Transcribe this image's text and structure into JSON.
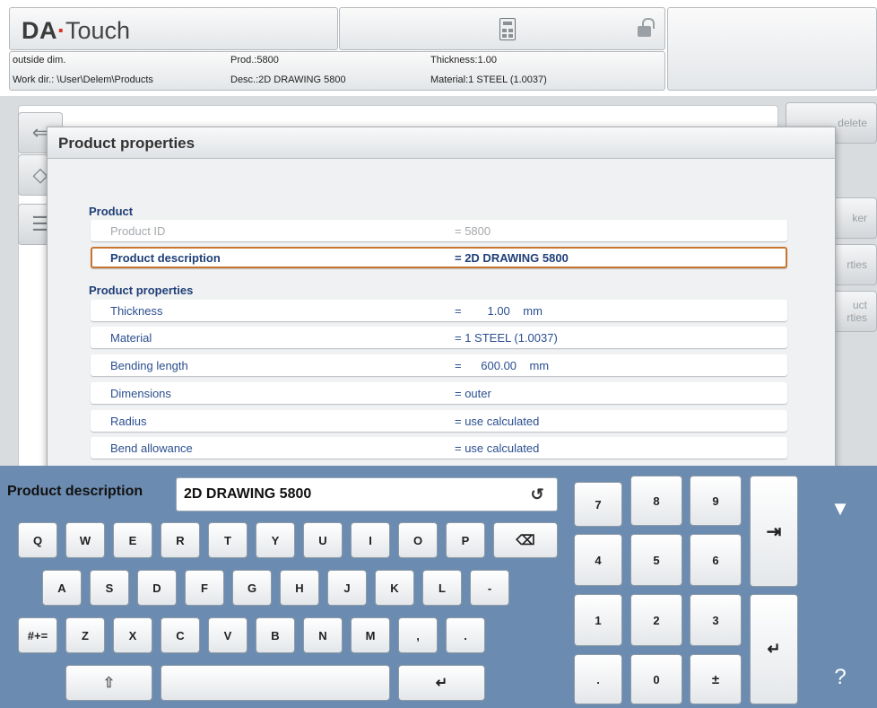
{
  "header": {
    "logo_brand": "DA",
    "logo_dot": "·",
    "logo_product": "Touch",
    "info": {
      "mode": "outside dim.",
      "workdir": "Work dir.: \\User\\Delem\\Products",
      "prod": "Prod.:5800",
      "desc": "Desc.:2D DRAWING 5800",
      "thickness": "Thickness:1.00",
      "material": "Material:1 STEEL (1.0037)"
    }
  },
  "background": {
    "side_buttons": [
      "delete",
      "ker",
      "rties",
      "uct\nrties"
    ]
  },
  "dialog": {
    "title": "Product properties",
    "sections": {
      "product": "Product",
      "properties": "Product properties"
    },
    "rows": [
      {
        "label": "Product ID",
        "value": "= 5800"
      },
      {
        "label": "Product description",
        "value": "= 2D DRAWING 5800"
      },
      {
        "label": "Thickness",
        "value": "=        1.00    mm"
      },
      {
        "label": "Material",
        "value": "= 1 STEEL (1.0037)"
      },
      {
        "label": "Bending length",
        "value": "=      600.00    mm"
      },
      {
        "label": "Dimensions",
        "value": "= outer"
      },
      {
        "label": "Radius",
        "value": "= use calculated"
      },
      {
        "label": "Bend allowance",
        "value": "= use calculated"
      }
    ]
  },
  "keyboard": {
    "input_label": "Product description",
    "input_value": "2D DRAWING 5800",
    "undo_icon": "↺",
    "row1": [
      "Q",
      "W",
      "E",
      "R",
      "T",
      "Y",
      "U",
      "I",
      "O",
      "P"
    ],
    "row2": [
      "A",
      "S",
      "D",
      "F",
      "G",
      "H",
      "J",
      "K",
      "L",
      "-"
    ],
    "row3": [
      "Z",
      "X",
      "C",
      "V",
      "B",
      "N",
      "M",
      ",",
      "."
    ],
    "symbols": "#+=",
    "backspace": "⌫",
    "shift": "⇧",
    "enter": "↵",
    "numpad": [
      "7",
      "8",
      "9",
      "4",
      "5",
      "6",
      "1",
      "2",
      "3",
      ".",
      "0",
      "±"
    ],
    "tab_icon": "⇥",
    "collapse_icon": "▼",
    "help": "?"
  },
  "colors": {
    "accent_text": "#1f3f78",
    "selected_border": "#c8762f",
    "keyboard_bg": "#6b8cb0",
    "logo_dot": "#e0301e"
  }
}
